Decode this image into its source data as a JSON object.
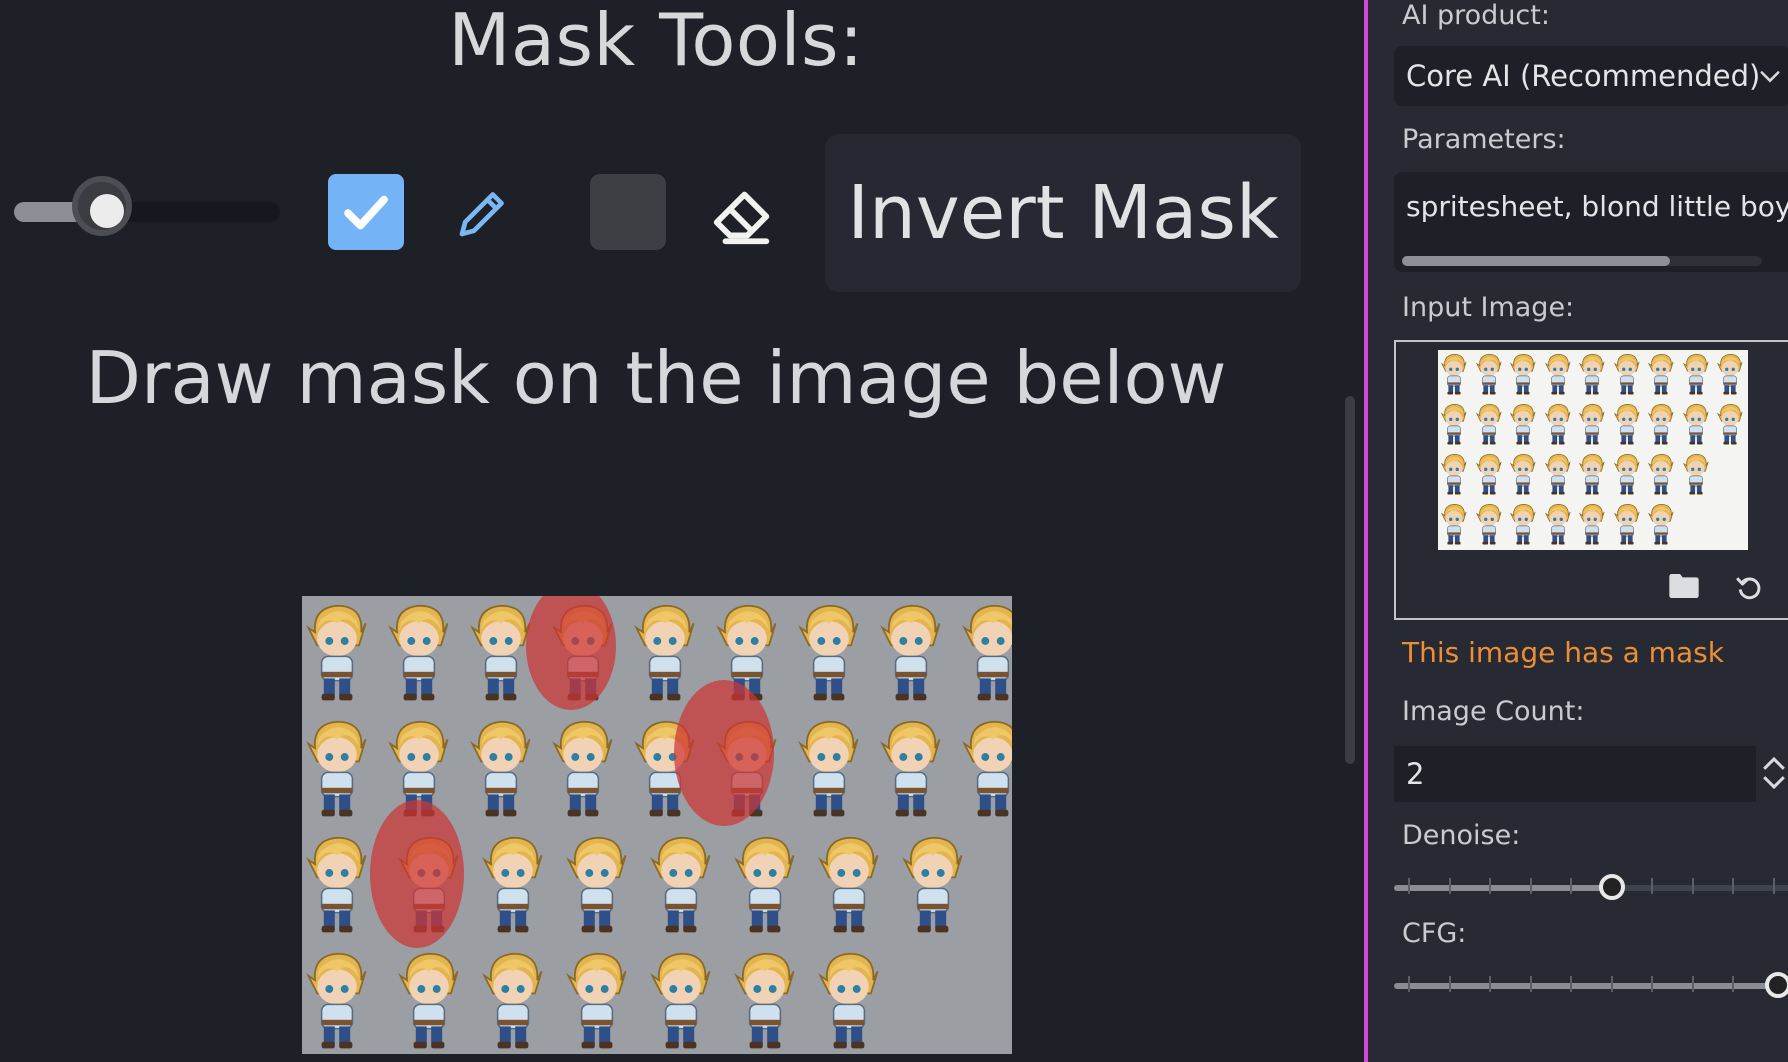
{
  "mask_tools": {
    "title": "Mask Tools:",
    "brush_size_fraction": 0.35,
    "pencil_enabled": true,
    "eraser_enabled": false,
    "invert_label": "Invert Mask",
    "hint": "Draw mask on the image below"
  },
  "canvas": {
    "sprite_rows": [
      9,
      9,
      8,
      7
    ],
    "mask_regions": 3
  },
  "inspector": {
    "ai_product_label": "AI product:",
    "ai_product_value": "Core AI (Recommended)",
    "parameters_label": "Parameters:",
    "parameters_value": "spritesheet, blond little boy",
    "input_image_label": "Input Image:",
    "mask_notice": "This image has a mask",
    "image_count_label": "Image Count:",
    "image_count_value": "2",
    "denoise_label": "Denoise:",
    "denoise_fraction": 0.56,
    "cfg_label": "CFG:",
    "cfg_fraction": 1.0
  },
  "colors": {
    "accent": "#d149d6",
    "check": "#74b4f6",
    "warning": "#ec8e36",
    "mask": "#cd3434"
  },
  "icons": [
    "check-icon",
    "pencil-icon",
    "eraser-icon",
    "folder-icon",
    "reset-icon",
    "chevron-down-icon",
    "spin-arrows-icon"
  ]
}
